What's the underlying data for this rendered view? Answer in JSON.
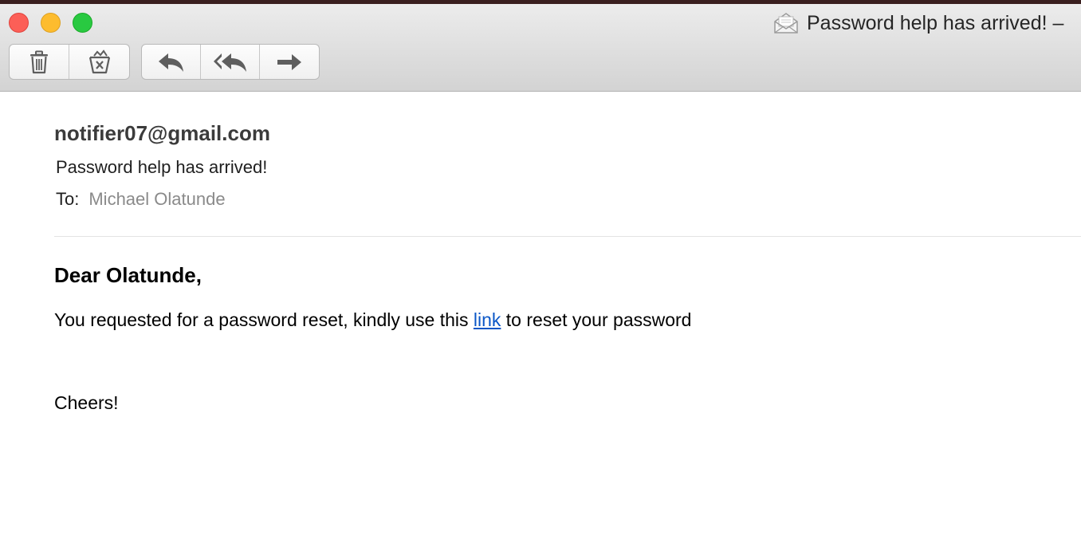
{
  "window": {
    "title": "Password help has arrived! –",
    "icon": "envelope-open-icon"
  },
  "toolbar": {
    "delete_icon": "trash-icon",
    "junk_icon": "junk-icon",
    "reply_icon": "reply-icon",
    "reply_all_icon": "reply-all-icon",
    "forward_icon": "forward-icon"
  },
  "message": {
    "from": "notifier07@gmail.com",
    "subject": "Password help has arrived!",
    "to_label": "To:",
    "to_name": "Michael Olatunde",
    "greeting": "Dear Olatunde,",
    "body_before_link": "You requested for a password reset, kindly use this ",
    "link_text": "link",
    "body_after_link": " to reset your password",
    "signoff": "Cheers!"
  },
  "colors": {
    "close": "#fc5f57",
    "minimize": "#fdbc2e",
    "maximize": "#29c941",
    "link": "#0b57c7",
    "recipient": "#8a8a8a"
  }
}
